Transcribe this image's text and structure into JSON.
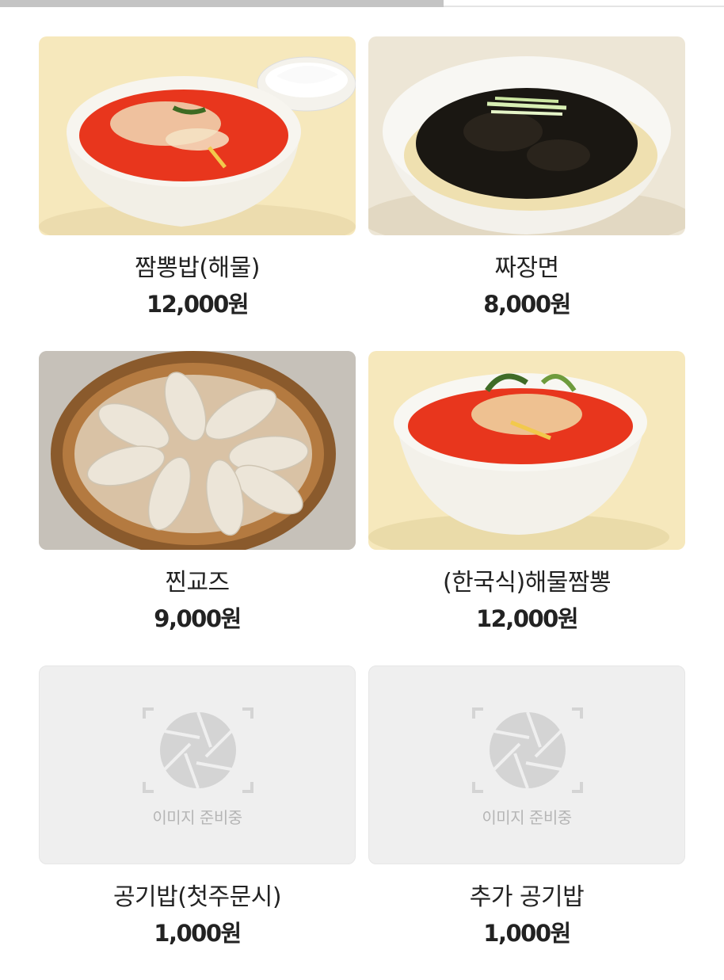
{
  "menu": {
    "items": [
      {
        "name": "짬뽕밥(해물)",
        "price": "12,000원",
        "image": "jjambbong-bap-photo"
      },
      {
        "name": "짜장면",
        "price": "8,000원",
        "image": "jjajangmyeon-photo"
      },
      {
        "name": "찐교즈",
        "price": "9,000원",
        "image": "steamed-dumplings-photo"
      },
      {
        "name": "(한국식)해물짬뽕",
        "price": "12,000원",
        "image": "seafood-jjambbong-photo"
      },
      {
        "name": "공기밥(첫주문시)",
        "price": "1,000원",
        "image": "placeholder"
      },
      {
        "name": "추가 공기밥",
        "price": "1,000원",
        "image": "placeholder"
      }
    ],
    "placeholder_text": "이미지 준비중",
    "placeholder_icon": "camera-aperture-icon"
  },
  "colors": {
    "soup_red": "#e8361d",
    "bowl_white": "#f7f5ef",
    "photo_bg": "#f6e8bc",
    "placeholder_bg": "#efefef",
    "placeholder_icon": "#d4d4d4",
    "text": "#222222"
  }
}
